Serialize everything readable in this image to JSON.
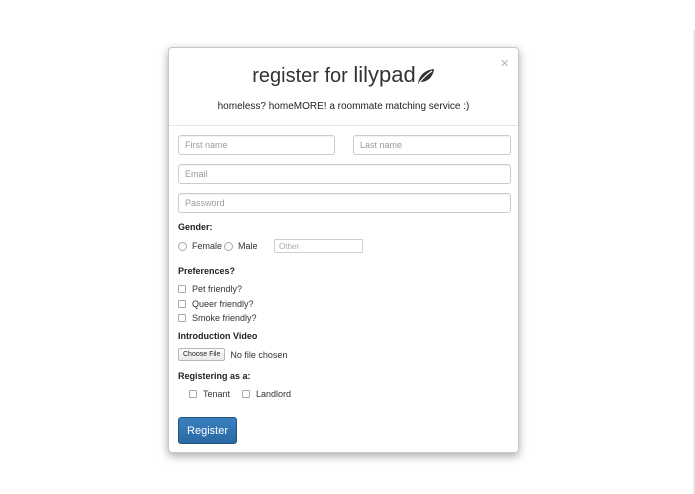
{
  "header": {
    "title_prefix": "register for ",
    "brand": "lilypad",
    "tagline": "homeless? homeMORE! a roommate matching service :)",
    "close_symbol": "×"
  },
  "form": {
    "first_name_placeholder": "First name",
    "last_name_placeholder": "Last name",
    "email_placeholder": "Email",
    "password_placeholder": "Password",
    "gender": {
      "label": "Gender:",
      "options": [
        "Female",
        "Male"
      ],
      "other_placeholder": "Other"
    },
    "preferences": {
      "label": "Preferences?",
      "options": [
        "Pet friendly?",
        "Queer friendly?",
        "Smoke friendly?"
      ]
    },
    "video": {
      "label": "Introduction Video",
      "button": "Choose File",
      "status": "No file chosen"
    },
    "registering": {
      "label": "Registering as a:",
      "options": [
        "Tenant",
        "Landlord"
      ]
    },
    "submit_label": "Register"
  },
  "icons": {
    "brand_logo": "leaf-icon",
    "close": "close-icon"
  },
  "colors": {
    "primary_button": "#2d6ca8"
  }
}
